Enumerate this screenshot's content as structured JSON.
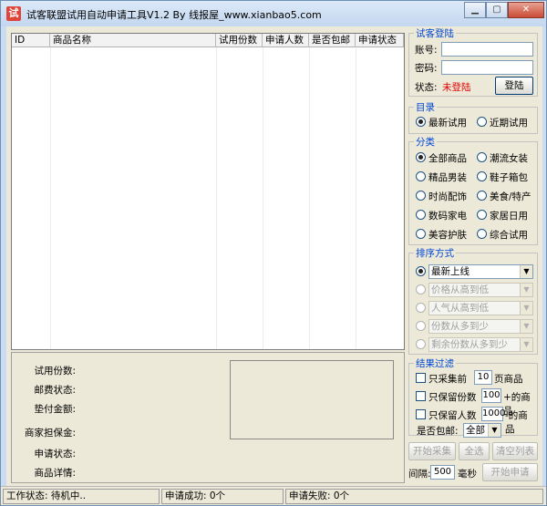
{
  "window": {
    "title": "试客联盟试用自动申请工具V1.2 By 线报屋_www.xianbao5.com",
    "app_icon": "试"
  },
  "table": {
    "columns": [
      "ID",
      "商品名称",
      "试用份数",
      "申请人数",
      "是否包邮",
      "申请状态"
    ]
  },
  "detail": {
    "labels": [
      "试用份数:",
      "邮费状态:",
      "垫付金额:",
      "商家担保金:",
      "申请状态:",
      "商品详情:"
    ]
  },
  "login": {
    "title": "试客登陆",
    "account_label": "账号:",
    "account_value": "",
    "password_label": "密码:",
    "password_value": "",
    "status_label": "状态:",
    "status_value": "未登陆",
    "status_color": "#e00000",
    "login_button": "登陆"
  },
  "catalog": {
    "title": "目录",
    "options": [
      {
        "label": "最新试用",
        "selected": true
      },
      {
        "label": "近期试用",
        "selected": false
      }
    ]
  },
  "category": {
    "title": "分类",
    "options": [
      {
        "label": "全部商品",
        "selected": true
      },
      {
        "label": "潮流女装",
        "selected": false
      },
      {
        "label": "精品男装",
        "selected": false
      },
      {
        "label": "鞋子箱包",
        "selected": false
      },
      {
        "label": "时尚配饰",
        "selected": false
      },
      {
        "label": "美食/特产",
        "selected": false
      },
      {
        "label": "数码家电",
        "selected": false
      },
      {
        "label": "家居日用",
        "selected": false
      },
      {
        "label": "美容护肤",
        "selected": false
      },
      {
        "label": "综合试用",
        "selected": false
      }
    ]
  },
  "sort": {
    "title": "排序方式",
    "options": [
      {
        "value": "最新上线",
        "selected": true,
        "enabled": true
      },
      {
        "value": "价格从高到低",
        "selected": false,
        "enabled": false
      },
      {
        "value": "人气从高到低",
        "selected": false,
        "enabled": false
      },
      {
        "value": "份数从多到少",
        "selected": false,
        "enabled": false
      },
      {
        "value": "剩余份数从多到少",
        "selected": false,
        "enabled": false
      }
    ]
  },
  "filter": {
    "title": "结果过滤",
    "collect_pre": "只采集前",
    "collect_value": "10",
    "collect_post": "页商品",
    "keep_copies_pre": "只保留份数",
    "keep_copies_value": "100",
    "keep_copies_post": "+的商品",
    "keep_people_pre": "只保留人数",
    "keep_people_value": "1000",
    "keep_people_post": "-的商品",
    "shipping_label": "是否包邮:",
    "shipping_value": "全部"
  },
  "actions": {
    "start_collect": "开始采集",
    "select_all": "全选",
    "clear_list": "清空列表",
    "interval_label": "间隔:",
    "interval_value": "500",
    "interval_unit": "毫秒",
    "start_apply": "开始申请"
  },
  "statusbar": {
    "work": "工作状态: 待机中..",
    "success": "申请成功: 0个",
    "fail": "申请失败: 0个"
  }
}
